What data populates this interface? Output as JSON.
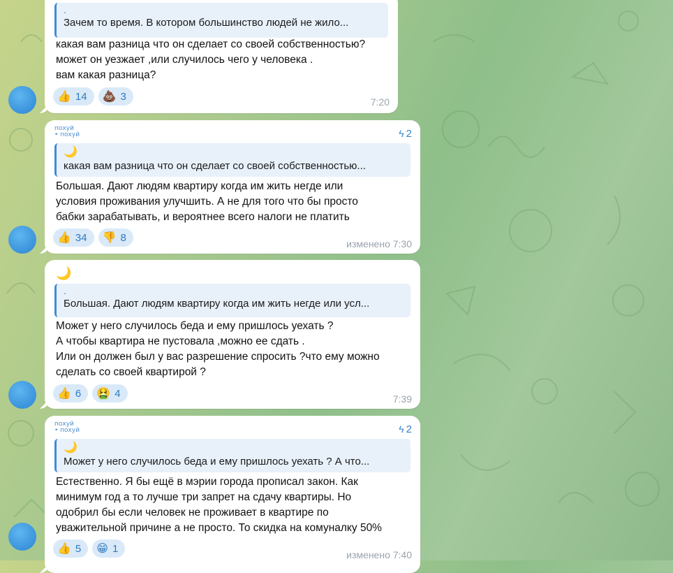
{
  "messages": [
    {
      "reply": {
        "name": ".",
        "text": "Зачем то время. В котором большинство людей не жило..."
      },
      "text": "какая вам разница что он сделает со своей собственностью?\nможет он уезжает ,или случилось чего у человека .\nвам какая разница?",
      "reactions": [
        {
          "emoji": "👍",
          "count": "14"
        },
        {
          "emoji": "💩",
          "count": "3"
        }
      ],
      "time": "7:20"
    },
    {
      "sender": [
        "похуй",
        "• похуй"
      ],
      "boost": "2",
      "moon": "🌙",
      "reply": {
        "text": "какая вам разница что он сделает со своей собственностью..."
      },
      "text": "Большая. Дают людям квартиру когда им жить негде или\nусловия проживания улучшить. А не для того что бы просто\nбабки зарабатывать,  и вероятнее всего налоги не платить",
      "reactions": [
        {
          "emoji": "👍",
          "count": "34"
        },
        {
          "emoji": "👎",
          "count": "8"
        }
      ],
      "time": "изменено 7:30"
    },
    {
      "moon": "🌙",
      "reply": {
        "name": ".",
        "text": "Большая. Дают людям квартиру когда им жить негде или усл..."
      },
      "text": "Может у него случилось беда и ему пришлось уехать ?\nА чтобы квартира не пустовала ,можно ее сдать  .\nИли он должен был у вас разрешение спросить ?что ему можно\nсделать со своей квартирой ?",
      "reactions": [
        {
          "emoji": "👍",
          "count": "6"
        },
        {
          "emoji": "🤮",
          "count": "4"
        }
      ],
      "time": "7:39"
    },
    {
      "sender": [
        "похуй",
        "• похуй"
      ],
      "boost": "2",
      "moon": "🌙",
      "reply": {
        "text": "Может у него случилось беда и ему пришлось уехать ? А что..."
      },
      "text": "Естественно.  Я бы ещё в мэрии города прописал закон. Как\nминимум год а то лучше три запрет на сдачу квартиры. Но\nодобрил бы если человек не проживает в квартире по\nуважительной причине а не просто. То скидка на комуналку 50%",
      "reactions": [
        {
          "emoji": "👍",
          "count": "5"
        },
        {
          "emoji": "😁",
          "count": "1"
        }
      ],
      "time": "изменено 7:40"
    }
  ],
  "icons": {
    "boost": "lightning-icon",
    "moon": "crescent-moon-icon"
  }
}
